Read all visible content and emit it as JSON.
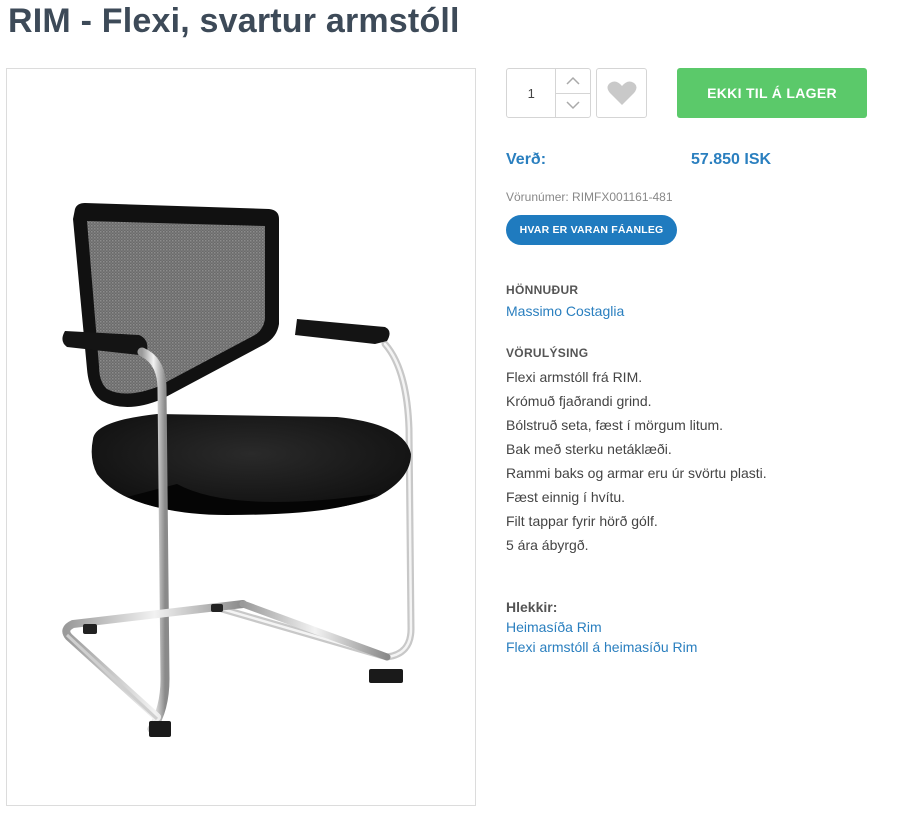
{
  "product": {
    "title": "RIM - Flexi, svartur armstóll"
  },
  "purchase": {
    "quantity": "1",
    "add_to_cart_label": "EKKI TIL Á LAGER"
  },
  "price": {
    "label": "Verð:",
    "value": "57.850 ISK"
  },
  "sku": {
    "text": "Vörunúmer: RIMFX001161-481"
  },
  "availability": {
    "button_label": "HVAR ER VARAN FÁANLEG"
  },
  "designer": {
    "heading": "HÖNNUÐUR",
    "name": "Massimo Costaglia"
  },
  "description": {
    "heading": "VÖRULÝSING",
    "lines": [
      "Flexi armstóll frá RIM.",
      "Krómuð fjaðrandi grind.",
      "Bólstruð seta, fæst í mörgum litum.",
      "Bak með sterku netáklæði.",
      "Rammi baks og armar eru úr svörtu plasti.",
      "Fæst einnig í hvítu.",
      "Filt tappar fyrir hörð gólf.",
      "5 ára ábyrgð."
    ]
  },
  "links": {
    "heading": "Hlekkir:",
    "items": [
      "Heimasíða Rim",
      "Flexi armstóll á heimasíðu Rim"
    ]
  },
  "icons": {
    "increment": "chevron-up-icon",
    "decrement": "chevron-down-icon",
    "wishlist": "heart-icon"
  },
  "colors": {
    "primary_blue": "#2a7fbf",
    "button_blue": "#1f7bbf",
    "cart_green": "#5bc96a",
    "title_gray": "#3d4a58"
  }
}
